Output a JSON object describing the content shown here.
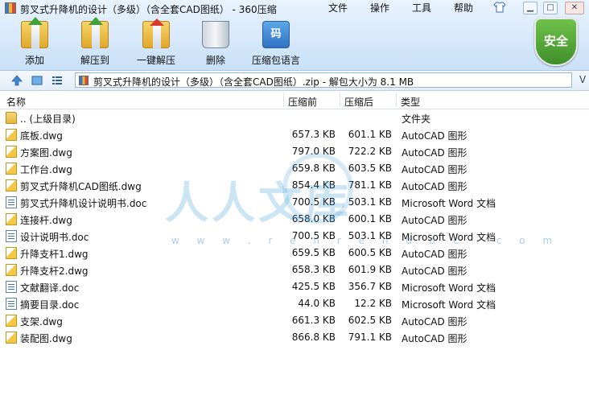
{
  "window": {
    "title": "剪叉式升降机的设计（多级）（含全套CAD图纸） - 360压缩"
  },
  "menu": {
    "items": [
      "文件",
      "操作",
      "工具",
      "帮助"
    ]
  },
  "window_controls": [
    "minimize",
    "maximize",
    "close"
  ],
  "toolbar": {
    "items": [
      {
        "label": "添加",
        "icon": "add-archive-icon"
      },
      {
        "label": "解压到",
        "icon": "extract-to-icon"
      },
      {
        "label": "一键解压",
        "icon": "one-click-extract-icon"
      },
      {
        "label": "删除",
        "icon": "delete-bin-icon"
      },
      {
        "label": "压缩包语言",
        "icon": "archive-language-icon",
        "glyph": "码"
      }
    ]
  },
  "security": {
    "label": "安全"
  },
  "address": {
    "path": "剪叉式升降机的设计（多级）（含全套CAD图纸）.zip - 解包大小为 8.1 MB",
    "dropdown_glyph": "V"
  },
  "columns": {
    "name": "名称",
    "size": "压缩前",
    "packed": "压缩后",
    "type": "类型"
  },
  "files": [
    {
      "name": ".. (上级目录)",
      "size": "",
      "packed": "",
      "type": "文件夹",
      "icon": "folder"
    },
    {
      "name": "底板.dwg",
      "size": "657.3 KB",
      "packed": "601.1 KB",
      "type": "AutoCAD 图形",
      "icon": "dwg"
    },
    {
      "name": "方案图.dwg",
      "size": "797.0 KB",
      "packed": "722.2 KB",
      "type": "AutoCAD 图形",
      "icon": "dwg"
    },
    {
      "name": "工作台.dwg",
      "size": "659.8 KB",
      "packed": "603.5 KB",
      "type": "AutoCAD 图形",
      "icon": "dwg"
    },
    {
      "name": "剪叉式升降机CAD图纸.dwg",
      "size": "854.4 KB",
      "packed": "781.1 KB",
      "type": "AutoCAD 图形",
      "icon": "dwg"
    },
    {
      "name": "剪叉式升降机设计说明书.doc",
      "size": "700.5 KB",
      "packed": "503.1 KB",
      "type": "Microsoft Word 文档",
      "icon": "doc"
    },
    {
      "name": "连接杆.dwg",
      "size": "658.0 KB",
      "packed": "600.1 KB",
      "type": "AutoCAD 图形",
      "icon": "dwg"
    },
    {
      "name": "设计说明书.doc",
      "size": "700.5 KB",
      "packed": "503.1 KB",
      "type": "Microsoft Word 文档",
      "icon": "doc"
    },
    {
      "name": "升降支杆1.dwg",
      "size": "659.5 KB",
      "packed": "600.5 KB",
      "type": "AutoCAD 图形",
      "icon": "dwg"
    },
    {
      "name": "升降支杆2.dwg",
      "size": "658.3 KB",
      "packed": "601.9 KB",
      "type": "AutoCAD 图形",
      "icon": "dwg"
    },
    {
      "name": "文献翻译.doc",
      "size": "425.5 KB",
      "packed": "356.7 KB",
      "type": "Microsoft Word 文档",
      "icon": "doc"
    },
    {
      "name": "摘要目录.doc",
      "size": "44.0 KB",
      "packed": "12.2 KB",
      "type": "Microsoft Word 文档",
      "icon": "doc"
    },
    {
      "name": "支架.dwg",
      "size": "661.3 KB",
      "packed": "602.5 KB",
      "type": "AutoCAD 图形",
      "icon": "dwg"
    },
    {
      "name": "装配图.dwg",
      "size": "866.8 KB",
      "packed": "791.1 KB",
      "type": "AutoCAD 图形",
      "icon": "dwg"
    }
  ],
  "watermark": {
    "text": "人人文库",
    "url": "w w w . r e n r e n d o c . c o m"
  },
  "colors": {
    "chrome": "#d7e9fb",
    "shield": "#4fa334",
    "accent": "#2f72c2"
  }
}
